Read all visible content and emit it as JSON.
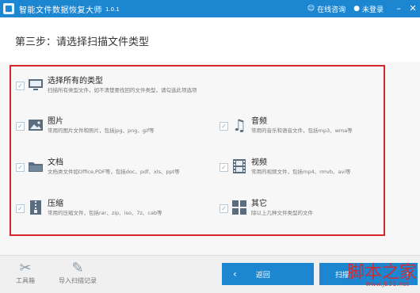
{
  "titlebar": {
    "title": "智能文件数据恢复大师",
    "version": "1.0.1",
    "consult": "在线咨询",
    "login": "未登录"
  },
  "step": {
    "title": "第三步：请选择扫描文件类型"
  },
  "types": {
    "all": {
      "name": "选择所有的类型",
      "desc": "扫描所有类型文件，如不清楚要找回的文件类型，请勾选此项选项",
      "checked": true
    },
    "image": {
      "name": "图片",
      "desc": "常用的图片文件和照片，包括jpg、png、gif等",
      "checked": true
    },
    "audio": {
      "name": "音频",
      "desc": "常用的音乐和语音文件，包括mp3、wma等",
      "checked": true
    },
    "doc": {
      "name": "文档",
      "desc": "文档类文件如Office,PDF等，包括doc、pdf、xls、ppt等",
      "checked": true
    },
    "video": {
      "name": "视频",
      "desc": "常用的视频文件，包括mp4、rmvb、avi等",
      "checked": true
    },
    "archive": {
      "name": "压缩",
      "desc": "常用的压缩文件，包括rar、zip、iso、7z、cab等",
      "checked": true
    },
    "other": {
      "name": "其它",
      "desc": "除以上几种文件类型的文件",
      "checked": true
    }
  },
  "bottom": {
    "toolbox": "工具箱",
    "import": "导入扫描记录",
    "back": "返回",
    "next": "扫描"
  },
  "watermark": {
    "text": "脚本之家",
    "url": "www.jb51.net"
  },
  "colors": {
    "accent": "#1c86d1",
    "highlight": "#d9262c"
  }
}
